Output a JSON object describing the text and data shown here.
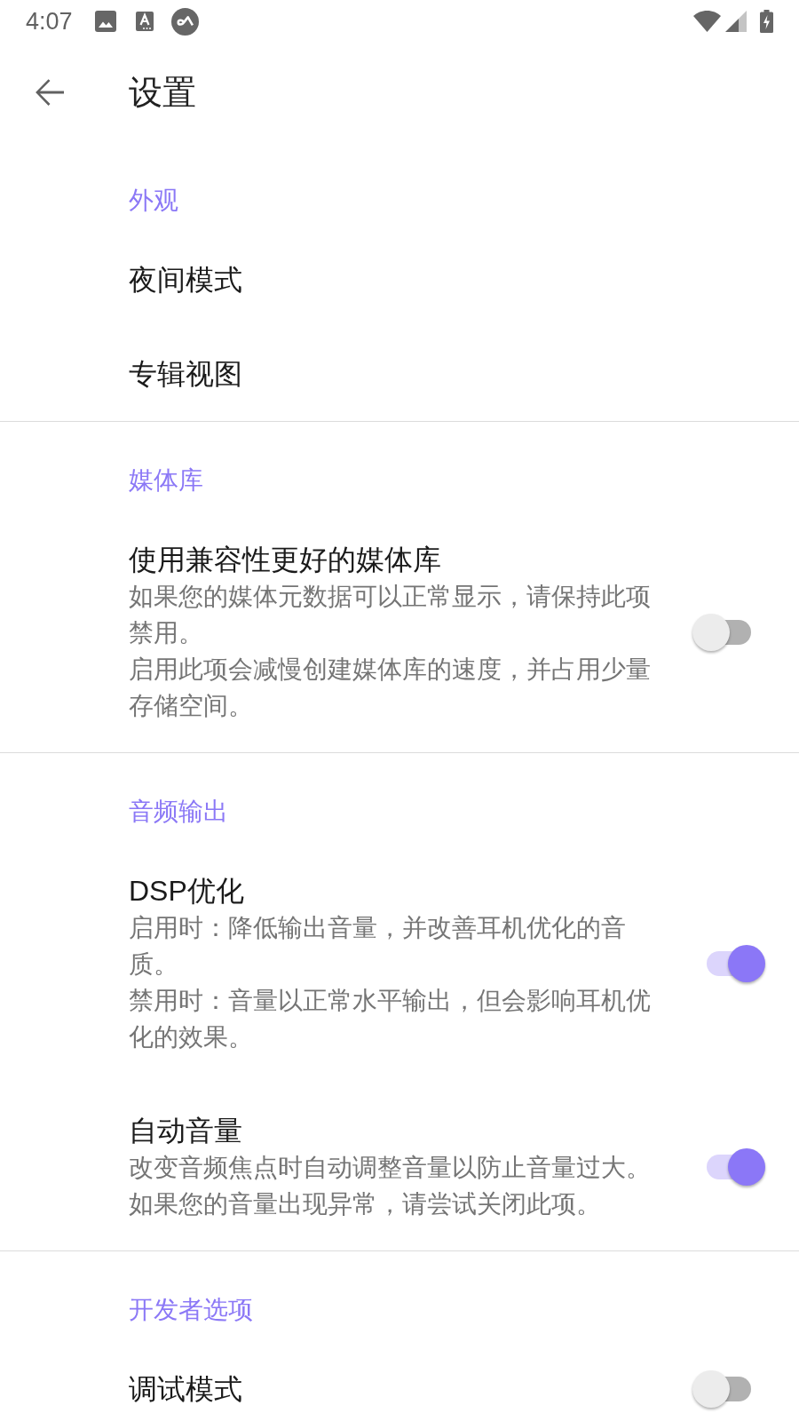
{
  "status_bar": {
    "time": "4:07"
  },
  "toolbar": {
    "title": "设置"
  },
  "sections": [
    {
      "header": "外观",
      "items": [
        {
          "kind": "plain",
          "title": "夜间模式"
        },
        {
          "kind": "plain",
          "title": "专辑视图"
        }
      ]
    },
    {
      "header": "媒体库",
      "items": [
        {
          "kind": "switch",
          "title": "使用兼容性更好的媒体库",
          "summary": [
            "如果您的媒体元数据可以正常显示，请保持此项禁用。",
            "启用此项会减慢创建媒体库的速度，并占用少量存储空间。"
          ],
          "on": false
        }
      ]
    },
    {
      "header": "音频输出",
      "items": [
        {
          "kind": "switch",
          "title": "DSP优化",
          "summary": [
            "启用时：降低输出音量，并改善耳机优化的音质。",
            "禁用时：音量以正常水平输出，但会影响耳机优化的效果。"
          ],
          "on": true
        },
        {
          "kind": "switch",
          "title": "自动音量",
          "summary": [
            "改变音频焦点时自动调整音量以防止音量过大。",
            "如果您的音量出现异常，请尝试关闭此项。"
          ],
          "on": true
        }
      ]
    },
    {
      "header": "开发者选项",
      "items": [
        {
          "kind": "switch",
          "title": "调试模式",
          "on": false
        }
      ]
    }
  ]
}
